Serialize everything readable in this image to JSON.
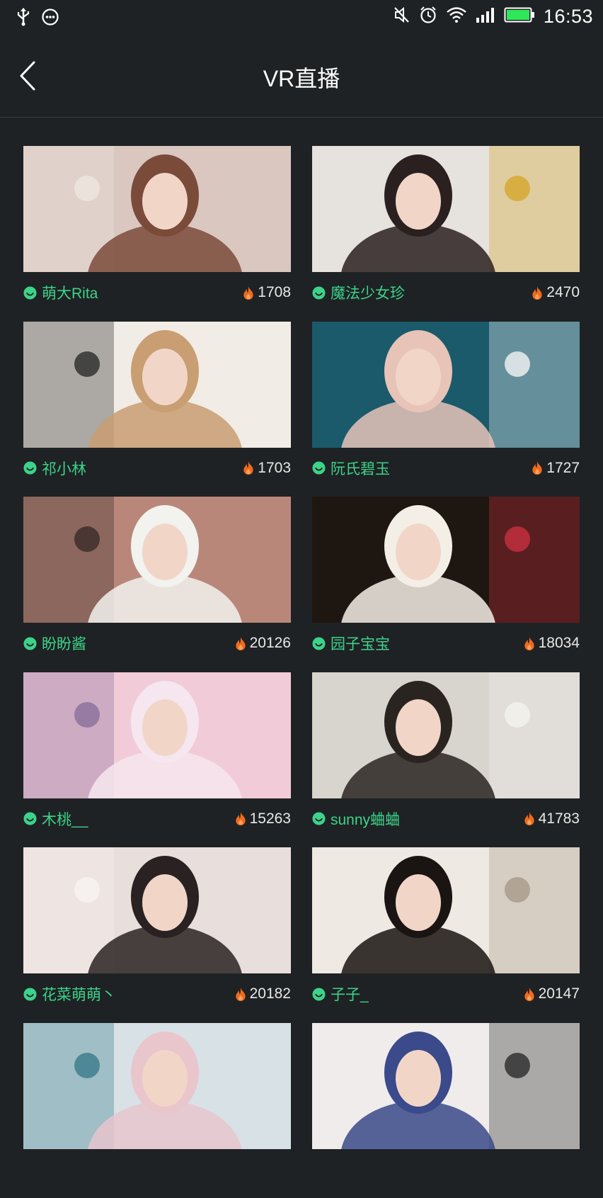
{
  "status_bar": {
    "time": "16:53",
    "icons": [
      "usb-icon",
      "message-icon",
      "mute-icon",
      "alarm-icon",
      "wifi-icon",
      "signal-icon",
      "battery-icon"
    ],
    "accent": "#3cd38a"
  },
  "header": {
    "title": "VR直播",
    "back_icon": "chevron-left-icon"
  },
  "colors": {
    "background": "#1f2224",
    "name_green": "#3cd38a",
    "flame_orange": "#f06a1e"
  },
  "streams": [
    {
      "name": "萌大Rita",
      "viewers": "1708",
      "thumb": [
        "#d9c7c0",
        "#7b4b3a",
        "#efe6e0"
      ]
    },
    {
      "name": "魔法少女珍",
      "viewers": "2470",
      "thumb": [
        "#e6e2de",
        "#2a2020",
        "#d4a62a"
      ]
    },
    {
      "name": "祁小林",
      "viewers": "1703",
      "thumb": [
        "#f1ece5",
        "#c89e72",
        "#2a2a2a"
      ]
    },
    {
      "name": "阮氏碧玉",
      "viewers": "1727",
      "thumb": [
        "#1a5a6a",
        "#e7c3b8",
        "#f4f4f4"
      ]
    },
    {
      "name": "盼盼酱",
      "viewers": "20126",
      "thumb": [
        "#b9877a",
        "#f2f2ee",
        "#3a2a28"
      ]
    },
    {
      "name": "园子宝宝",
      "viewers": "18034",
      "thumb": [
        "#1e1610",
        "#f4efe6",
        "#c83040"
      ]
    },
    {
      "name": "木桃__",
      "viewers": "15263",
      "thumb": [
        "#f2cbd8",
        "#f6e6ef",
        "#8a6f9a"
      ]
    },
    {
      "name": "sunny蛐蛐",
      "viewers": "41783",
      "thumb": [
        "#d8d4ce",
        "#2a2420",
        "#f4f2ee"
      ]
    },
    {
      "name": "花菜萌萌丶",
      "viewers": "20182",
      "thumb": [
        "#e8dedc",
        "#2a2222",
        "#f8f4f0"
      ]
    },
    {
      "name": "子子_",
      "viewers": "20147",
      "thumb": [
        "#efe9e4",
        "#1a1412",
        "#a89a88"
      ]
    },
    {
      "name": "",
      "viewers": "",
      "thumb": [
        "#d8e2e6",
        "#e8c6cc",
        "#3a7a8a"
      ]
    },
    {
      "name": "",
      "viewers": "",
      "thumb": [
        "#f0ecec",
        "#3a4a8a",
        "#2a2a2a"
      ]
    }
  ]
}
